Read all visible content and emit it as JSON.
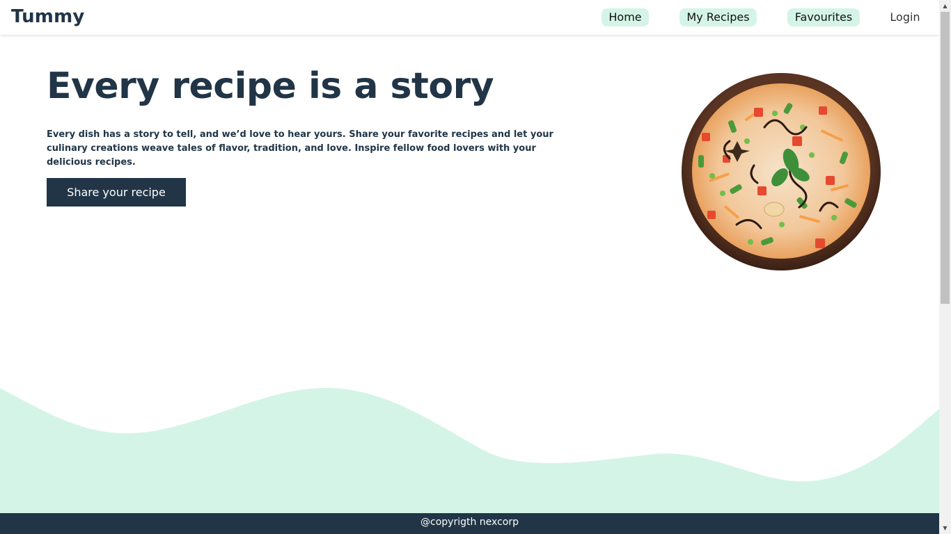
{
  "nav": {
    "logo": "Tummy",
    "items": [
      {
        "label": "Home"
      },
      {
        "label": "My Recipes"
      },
      {
        "label": "Favourites"
      },
      {
        "label": "Login"
      }
    ]
  },
  "hero": {
    "title": "Every recipe is a story",
    "text": "Every dish has a story to tell, and we’d love to hear yours. Share your favorite recipes and let your culinary creations weave tales of flavor, tradition, and love. Inspire fellow food lovers with your delicious recipes.",
    "button_label": "Share your recipe"
  },
  "footer": {
    "text": "@copyrigth nexcorp"
  },
  "colors": {
    "primary": "#213547",
    "accent_mint": "#d4f4e7"
  },
  "icons": {
    "scroll_up": "scroll-up-arrow-icon",
    "scroll_down": "scroll-down-arrow-icon"
  }
}
